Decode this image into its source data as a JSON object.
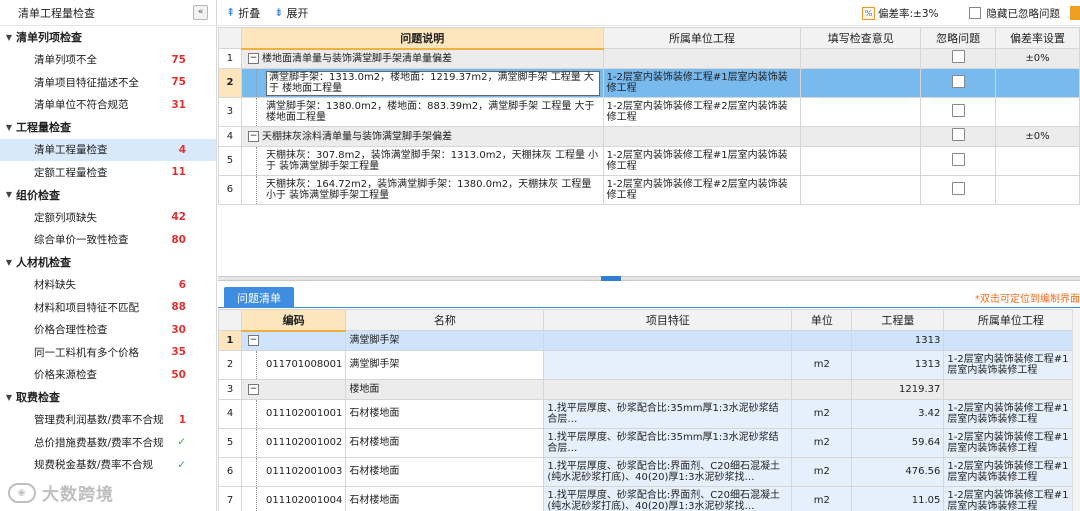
{
  "sidebar": {
    "title": "清单工程量检查",
    "collapse_icon": "«",
    "groups": [
      {
        "label": "清单列项检查",
        "items": [
          {
            "label": "清单列项不全",
            "count": "75"
          },
          {
            "label": "清单项目特征描述不全",
            "count": "75"
          },
          {
            "label": "清单单位不符合规范",
            "count": "31"
          }
        ]
      },
      {
        "label": "工程量检查",
        "items": [
          {
            "label": "清单工程量检查",
            "count": "4"
          },
          {
            "label": "定额工程量检查",
            "count": "11"
          }
        ]
      },
      {
        "label": "组价检查",
        "items": [
          {
            "label": "定额列项缺失",
            "count": "42"
          },
          {
            "label": "综合单价一致性检查",
            "count": "80"
          }
        ]
      },
      {
        "label": "人材机检查",
        "items": [
          {
            "label": "材料缺失",
            "count": "6"
          },
          {
            "label": "材料和项目特征不匹配",
            "count": "88"
          },
          {
            "label": "价格合理性检查",
            "count": "30"
          },
          {
            "label": "同一工料机有多个价格",
            "count": "35"
          },
          {
            "label": "价格来源检查",
            "count": "50"
          }
        ]
      },
      {
        "label": "取费检查",
        "items": [
          {
            "label": "管理费利润基数/费率不合规",
            "count": "1"
          },
          {
            "label": "总价措施费基数/费率不合规",
            "count": "✓"
          },
          {
            "label": "规费税金基数/费率不合规",
            "count": "✓"
          }
        ]
      }
    ]
  },
  "watermark": {
    "text": "大数跨境"
  },
  "toolbar": {
    "collapse_label": "折叠",
    "expand_label": "展开",
    "deviation_label": "偏差率:±3%",
    "hide_ignored_label": "隐藏已忽略问题"
  },
  "top_table": {
    "headers": [
      "",
      "问题说明",
      "所属单位工程",
      "填写检查意见",
      "忽略问题",
      "偏差率设置"
    ],
    "rows": [
      {
        "no": "1",
        "group": true,
        "desc": "楼地面清单量与装饰满堂脚手架清单量偏差",
        "unit": "",
        "rate": "±0%"
      },
      {
        "no": "2",
        "group": false,
        "desc": "满堂脚手架：1313.0m2，楼地面：1219.37m2，满堂脚手架 工程量 大于 楼地面工程量",
        "unit": "1-2层室内装饰装修工程#1层室内装饰装修工程",
        "rate": ""
      },
      {
        "no": "3",
        "group": false,
        "desc": "满堂脚手架：1380.0m2，楼地面：883.39m2，满堂脚手架 工程量 大于 楼地面工程量",
        "unit": "1-2层室内装饰装修工程#2层室内装饰装修工程",
        "rate": ""
      },
      {
        "no": "4",
        "group": true,
        "desc": "天棚抹灰涂料清单量与装饰满堂脚手架偏差",
        "unit": "",
        "rate": "±0%"
      },
      {
        "no": "5",
        "group": false,
        "desc": "天棚抹灰：307.8m2，装饰满堂脚手架：1313.0m2，天棚抹灰 工程量 小于 装饰满堂脚手架工程量",
        "unit": "1-2层室内装饰装修工程#1层室内装饰装修工程",
        "rate": ""
      },
      {
        "no": "6",
        "group": false,
        "desc": "天棚抹灰：164.72m2，装饰满堂脚手架：1380.0m2，天棚抹灰 工程量 小于 装饰满堂脚手架工程量",
        "unit": "1-2层室内装饰装修工程#2层室内装饰装修工程",
        "rate": ""
      }
    ]
  },
  "bottom": {
    "tab_label": "问题清单",
    "hint": "*双击可定位到编制界面",
    "headers": [
      "",
      "编码",
      "名称",
      "项目特征",
      "单位",
      "工程量",
      "所属单位工程"
    ],
    "rows": [
      {
        "no": "1",
        "group": true,
        "code": "",
        "name": "满堂脚手架",
        "feature": "",
        "unit": "",
        "qty": "1313",
        "belong": ""
      },
      {
        "no": "2",
        "group": false,
        "code": "011701008001",
        "name": "满堂脚手架",
        "feature": "",
        "unit": "m2",
        "qty": "1313",
        "belong": "1-2层室内装饰装修工程#1层室内装饰装修工程"
      },
      {
        "no": "3",
        "group": true,
        "code": "",
        "name": "楼地面",
        "feature": "",
        "unit": "",
        "qty": "1219.37",
        "belong": ""
      },
      {
        "no": "4",
        "group": false,
        "code": "011102001001",
        "name": "石材楼地面",
        "feature": "1.找平层厚度、砂浆配合比:35mm厚1:3水泥砂浆结合层…",
        "unit": "m2",
        "qty": "3.42",
        "belong": "1-2层室内装饰装修工程#1层室内装饰装修工程"
      },
      {
        "no": "5",
        "group": false,
        "code": "011102001002",
        "name": "石材楼地面",
        "feature": "1.找平层厚度、砂浆配合比:35mm厚1:3水泥砂浆结合层…",
        "unit": "m2",
        "qty": "59.64",
        "belong": "1-2层室内装饰装修工程#1层室内装饰装修工程"
      },
      {
        "no": "6",
        "group": false,
        "code": "011102001003",
        "name": "石材楼地面",
        "feature": "1.找平层厚度、砂浆配合比:界面剂、C20细石混凝土(纯水泥砂浆打底)、40(20)厚1:3水泥砂浆找…",
        "unit": "m2",
        "qty": "476.56",
        "belong": "1-2层室内装饰装修工程#1层室内装饰装修工程"
      },
      {
        "no": "7",
        "group": false,
        "code": "011102001004",
        "name": "石材楼地面",
        "feature": "1.找平层厚度、砂浆配合比:界面剂、C20细石混凝土(纯水泥砂浆打底)、40(20)厚1:3水泥砂浆找…",
        "unit": "m2",
        "qty": "11.05",
        "belong": "1-2层室内装饰装修工程#1层室内装饰装修工程"
      }
    ]
  }
}
